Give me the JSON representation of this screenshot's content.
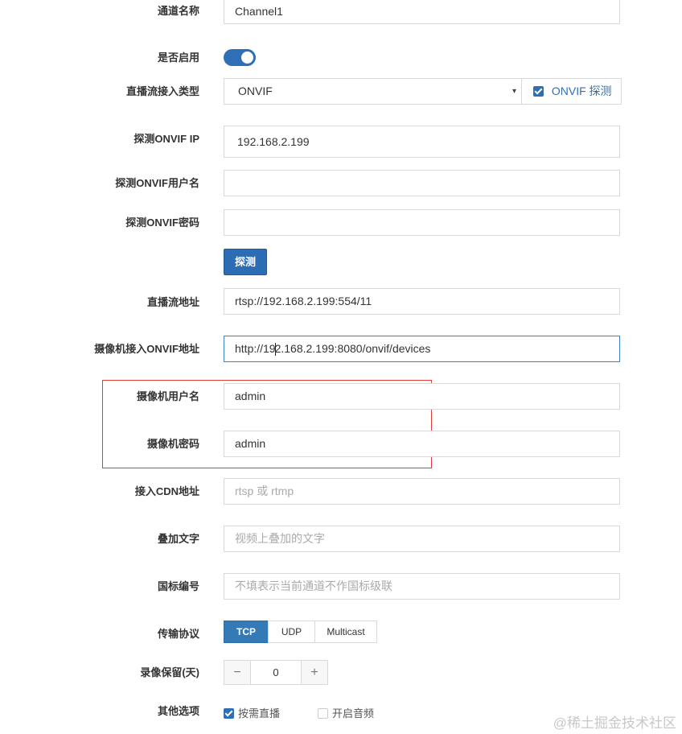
{
  "fields": {
    "channel_name": {
      "label": "通道名称",
      "value": "Channel1"
    },
    "enabled": {
      "label": "是否启用",
      "on": true
    },
    "stream_type": {
      "label": "直播流接入类型",
      "value": "ONVIF",
      "probe_checkbox_label": "ONVIF 探测",
      "probe_checked": true
    },
    "probe_ip": {
      "label": "探测ONVIF IP",
      "value": "192.168.2.199"
    },
    "probe_user": {
      "label": "探测ONVIF用户名",
      "value": ""
    },
    "probe_password": {
      "label": "探测ONVIF密码",
      "value": ""
    },
    "probe_button": "探测",
    "stream_url": {
      "label": "直播流地址",
      "value": "rtsp://192.168.2.199:554/11"
    },
    "onvif_url": {
      "label": "摄像机接入ONVIF地址",
      "value_before_caret": "http://19",
      "value_after_caret": "2.168.2.199:8080/onvif/devices"
    },
    "camera_user": {
      "label": "摄像机用户名",
      "value": "admin"
    },
    "camera_password": {
      "label": "摄像机密码",
      "value": "admin"
    },
    "cdn_url": {
      "label": "接入CDN地址",
      "placeholder": "rtsp 或 rtmp"
    },
    "overlay_text": {
      "label": "叠加文字",
      "placeholder": "视频上叠加的文字"
    },
    "gb_code": {
      "label": "国标编号",
      "placeholder": "不填表示当前通道不作国标级联"
    },
    "protocol": {
      "label": "传输协议",
      "options": [
        "TCP",
        "UDP",
        "Multicast"
      ],
      "selected": "TCP"
    },
    "record_days": {
      "label": "录像保留(天)",
      "value": "0",
      "minus": "−",
      "plus": "+"
    },
    "other_options": {
      "label": "其他选项",
      "items": [
        {
          "label": "按需直播",
          "checked": true
        },
        {
          "label": "开启音频",
          "checked": false
        }
      ]
    }
  },
  "watermark": "@稀土掘金技术社区",
  "colors": {
    "primary": "#2f6fb5",
    "highlight_box": "#e03e3e"
  },
  "icons": {
    "select_arrow": "▾",
    "check": "check-icon"
  }
}
